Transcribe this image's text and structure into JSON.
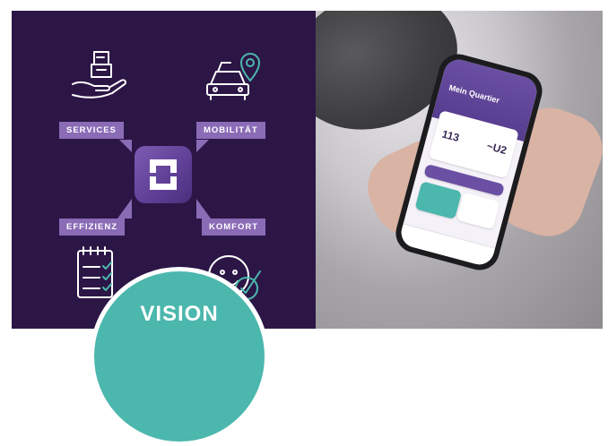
{
  "left_panel": {
    "background": "#2c1646",
    "label_color": "#8a6bb6",
    "icon_color": "#ffffff",
    "accent": "#4bb7ad",
    "labels": {
      "services": "SERVICES",
      "mobilitaet": "MOBILITÄT",
      "effizienz": "EFFIZIENZ",
      "komfort": "KOMFORT"
    },
    "icons": [
      "building-in-hand-icon",
      "car-with-location-pin-icon",
      "checklist-icon",
      "smiley-with-checkmark-icon"
    ],
    "center_logo": "logo-mark"
  },
  "right_panel": {
    "phone_screen": {
      "title": "Mein Quartier",
      "values": [
        "113",
        "~U2"
      ]
    },
    "badge": {
      "text": "VISION",
      "color": "#4bb7ad"
    }
  }
}
